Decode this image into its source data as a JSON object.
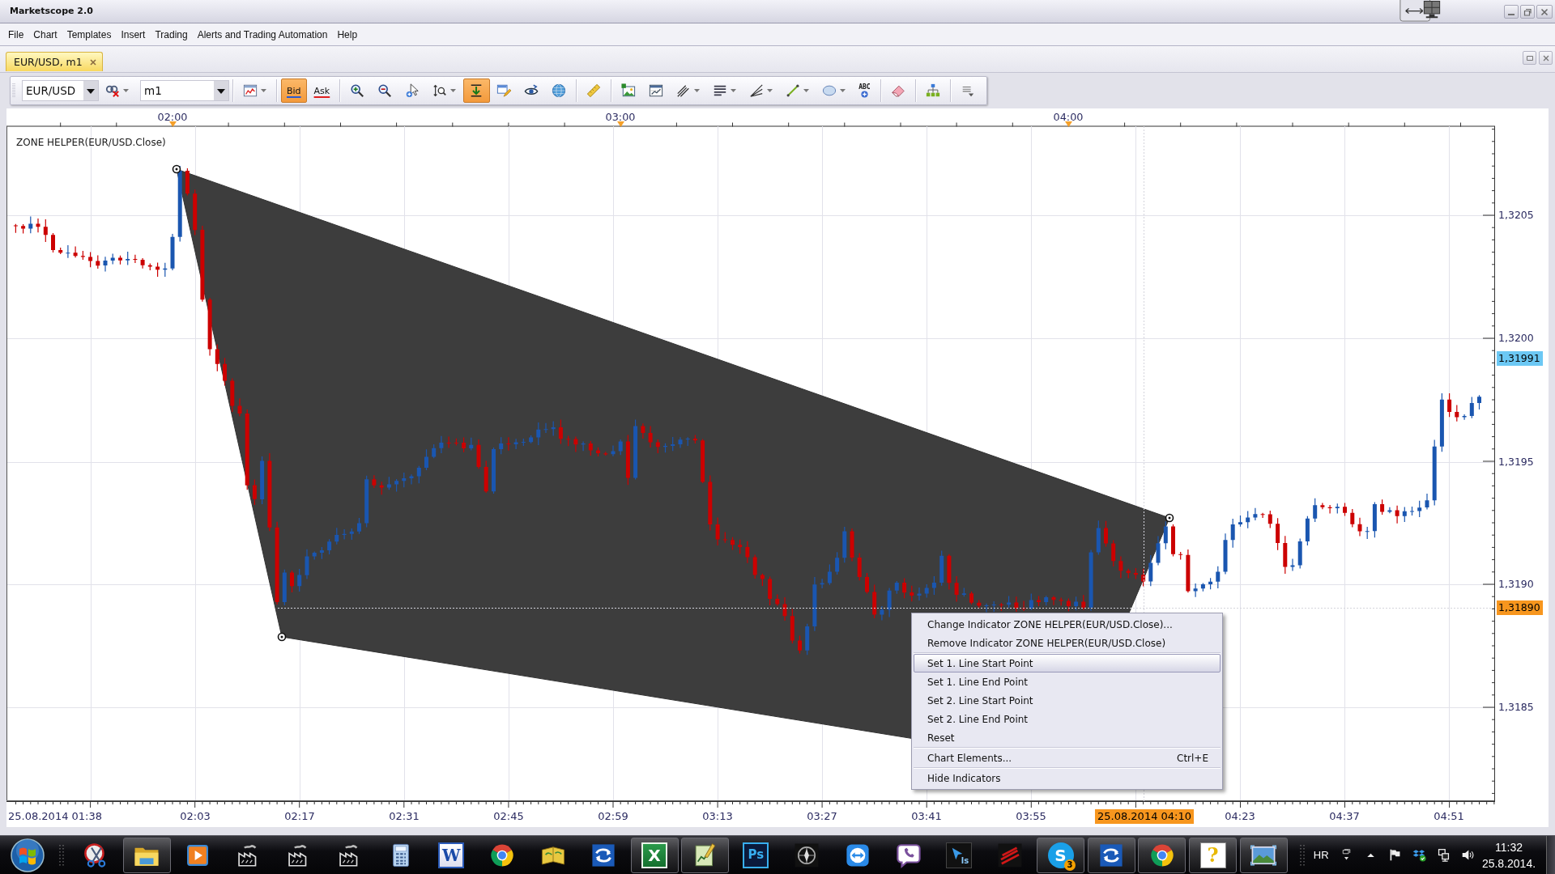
{
  "window": {
    "title": "Marketscope 2.0"
  },
  "menu_bar": [
    "File",
    "Chart",
    "Templates",
    "Insert",
    "Trading",
    "Alerts and Trading Automation",
    "Help"
  ],
  "tabs": [
    {
      "label": "EUR/USD, m1",
      "selected": true
    }
  ],
  "toolbar": {
    "symbol": "EUR/USD",
    "timeframe": "m1",
    "groups": [
      {
        "buttons": [
          {
            "kind": "unlink",
            "on": false,
            "menu": true
          }
        ]
      },
      {
        "buttons": [
          {
            "kind": "chart-type",
            "on": false,
            "menu": true
          }
        ]
      },
      {
        "buttons": [
          {
            "kind": "bid",
            "label": "Bid",
            "on": true,
            "menu": false
          },
          {
            "kind": "ask",
            "label": "Ask",
            "on": false,
            "menu": false
          }
        ]
      },
      {
        "buttons": [
          {
            "kind": "zoom-in",
            "on": false,
            "menu": false
          },
          {
            "kind": "zoom-out",
            "on": false,
            "menu": false
          },
          {
            "kind": "cursor-zoom",
            "on": false,
            "menu": false
          },
          {
            "kind": "zoom-range",
            "on": false,
            "menu": true
          },
          {
            "kind": "autoscroll",
            "on": true,
            "menu": false
          },
          {
            "kind": "window-pen",
            "on": false,
            "menu": false
          },
          {
            "kind": "eye",
            "on": false,
            "menu": false
          },
          {
            "kind": "globe",
            "on": false,
            "menu": false
          }
        ]
      },
      {
        "buttons": [
          {
            "kind": "ruler",
            "on": false,
            "menu": false
          }
        ]
      },
      {
        "buttons": [
          {
            "kind": "image",
            "on": false,
            "menu": false
          },
          {
            "kind": "chart-window",
            "on": false,
            "menu": false
          },
          {
            "kind": "pitchfork",
            "on": false,
            "menu": true
          },
          {
            "kind": "lines",
            "on": false,
            "menu": true
          },
          {
            "kind": "fan",
            "on": false,
            "menu": true
          },
          {
            "kind": "line",
            "on": false,
            "menu": true
          },
          {
            "kind": "ellipse",
            "on": false,
            "menu": true
          },
          {
            "kind": "text",
            "label": "ABC",
            "on": false,
            "menu": false
          }
        ]
      },
      {
        "buttons": [
          {
            "kind": "eraser",
            "on": false,
            "menu": false
          }
        ]
      },
      {
        "buttons": [
          {
            "kind": "hierarchy",
            "on": false,
            "menu": false
          }
        ]
      },
      {
        "buttons": [
          {
            "kind": "overflow",
            "on": false,
            "menu": false
          }
        ]
      }
    ]
  },
  "chart": {
    "indicator_label": "ZONE HELPER(EUR/USD.Close)",
    "time_axis_top": [
      "02:00",
      "03:00",
      "04:00"
    ],
    "time_axis_bottom": [
      {
        "text": "25.08.2014 01:38",
        "kind": "start"
      },
      {
        "text": "02:03",
        "kind": "tick"
      },
      {
        "text": "02:17",
        "kind": "tick"
      },
      {
        "text": "02:31",
        "kind": "tick"
      },
      {
        "text": "02:45",
        "kind": "tick"
      },
      {
        "text": "02:59",
        "kind": "tick"
      },
      {
        "text": "03:13",
        "kind": "tick"
      },
      {
        "text": "03:27",
        "kind": "tick"
      },
      {
        "text": "03:41",
        "kind": "tick"
      },
      {
        "text": "03:55",
        "kind": "tick"
      },
      {
        "text": "25.08.2014 04:10",
        "kind": "cursor"
      },
      {
        "text": "04:23",
        "kind": "tick"
      },
      {
        "text": "04:37",
        "kind": "tick"
      },
      {
        "text": "04:51",
        "kind": "tick"
      }
    ],
    "price_axis": [
      {
        "text": "1,3205",
        "kind": "tick"
      },
      {
        "text": "1,3200",
        "kind": "tick"
      },
      {
        "text": "1,31991",
        "kind": "bid"
      },
      {
        "text": "1,3195",
        "kind": "tick"
      },
      {
        "text": "1,3190",
        "kind": "tick"
      },
      {
        "text": "1,31890",
        "kind": "cursor"
      },
      {
        "text": "1,3185",
        "kind": "tick"
      }
    ]
  },
  "context_menu": {
    "groups": [
      {
        "items": [
          {
            "label": "Change Indicator ZONE HELPER(EUR/USD.Close)...",
            "selected": false
          },
          {
            "label": "Remove Indicator ZONE HELPER(EUR/USD.Close)",
            "selected": false
          }
        ]
      },
      {
        "items": [
          {
            "label": "Set 1. Line Start Point",
            "selected": true
          },
          {
            "label": "Set 1. Line End Point",
            "selected": false
          },
          {
            "label": "Set 2. Line Start Point",
            "selected": false
          },
          {
            "label": "Set 2. Line End Point",
            "selected": false
          },
          {
            "label": "Reset",
            "selected": false
          }
        ]
      },
      {
        "items": [
          {
            "label": "Chart Elements...",
            "shortcut": "Ctrl+E",
            "selected": false
          }
        ]
      },
      {
        "items": [
          {
            "label": "Hide Indicators",
            "selected": false
          }
        ]
      }
    ]
  },
  "taskbar": {
    "apps": [
      {
        "kind": "scissors",
        "running": false
      },
      {
        "kind": "folder",
        "running": true
      },
      {
        "kind": "media",
        "running": false
      },
      {
        "kind": "factory",
        "running": false
      },
      {
        "kind": "factory",
        "running": false
      },
      {
        "kind": "factory",
        "running": false
      },
      {
        "kind": "calculator",
        "running": false
      },
      {
        "kind": "word",
        "glyph": "W",
        "running": false
      },
      {
        "kind": "wheel",
        "running": false
      },
      {
        "kind": "book",
        "running": false
      },
      {
        "kind": "arrows",
        "running": false
      },
      {
        "kind": "excel",
        "glyph": "X",
        "running": true
      },
      {
        "kind": "notepad",
        "running": true
      },
      {
        "kind": "ps",
        "glyph": "Ps",
        "running": false
      },
      {
        "kind": "compass",
        "running": false
      },
      {
        "kind": "remote",
        "running": false
      },
      {
        "kind": "phone",
        "running": false
      },
      {
        "kind": "ls",
        "glyph": "ls",
        "running": false
      },
      {
        "kind": "stripes",
        "running": false
      },
      {
        "kind": "skype",
        "glyph": "S",
        "badge": "3",
        "running": true
      },
      {
        "kind": "arrows",
        "running": true
      },
      {
        "kind": "wheel",
        "running": true
      },
      {
        "kind": "help",
        "glyph": "?",
        "running": true
      },
      {
        "kind": "picture",
        "running": true
      }
    ],
    "tray": {
      "language": "HR",
      "time": "11:32",
      "date": "25.8.2014."
    }
  }
}
